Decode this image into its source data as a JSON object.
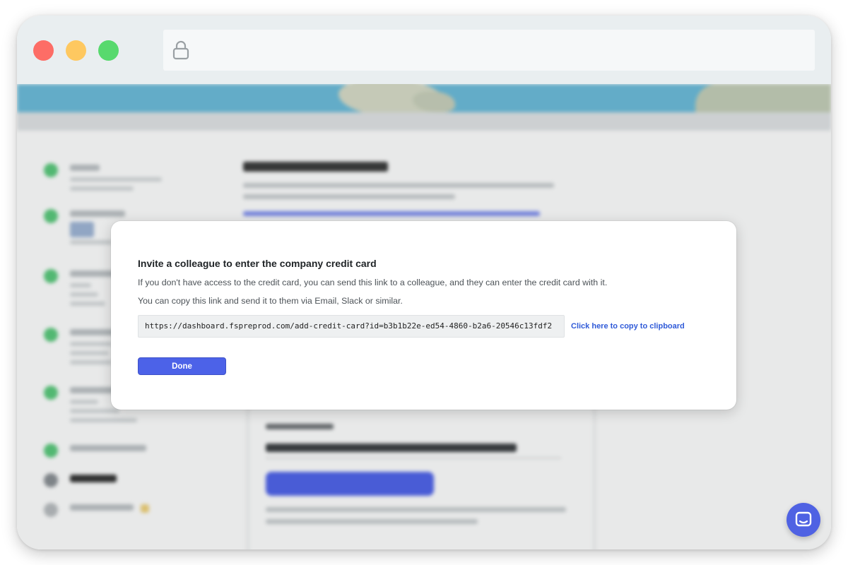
{
  "window": {
    "traffic_lights": {
      "close_color": "#fd6d66",
      "minimize_color": "#fec860",
      "maximize_color": "#58d96e"
    },
    "url_bar": {
      "icon": "lock-icon"
    }
  },
  "colors": {
    "accent": "#4c62e8",
    "link": "#2f5ad8",
    "step_complete": "#59c97b"
  },
  "modal": {
    "title": "Invite a colleague to enter the company credit card",
    "description": "If you don't have access to the credit card, you can send this link to a colleague, and they can enter the credit card with it.",
    "instructions": "You can copy this link and send it to them via Email, Slack or similar.",
    "invite_link": "https://dashboard.fspreprod.com/add-credit-card?id=b3b1b22e-ed54-4860-b2a6-20546c13fdf2",
    "copy_label": "Click here to copy to clipboard",
    "done_label": "Done"
  },
  "chat_widget": {
    "icon": "chat-icon"
  }
}
